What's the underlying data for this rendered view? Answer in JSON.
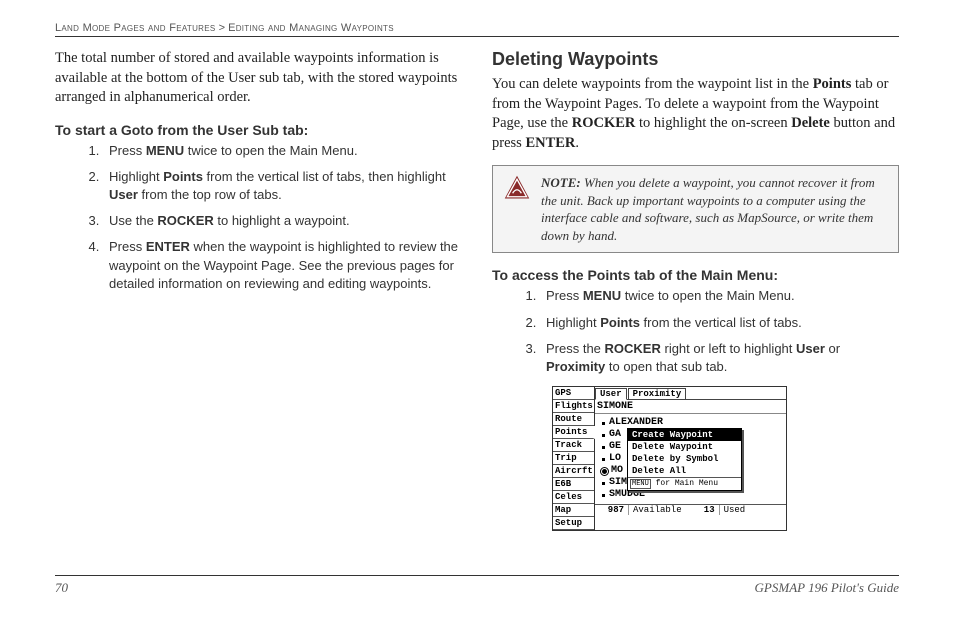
{
  "header": {
    "section": "Land Mode Pages and Features",
    "sep": " > ",
    "subsection": "Editing and Managing Waypoints"
  },
  "left": {
    "intro": "The total number of stored and available waypoints information is available at the bottom of the User sub tab, with the stored waypoints arranged in alphanumerical order.",
    "proc_title": "To start a Goto from the User Sub tab:",
    "steps": {
      "s1a": "Press ",
      "s1b": "MENU",
      "s1c": " twice to open the Main Menu.",
      "s2a": "Highlight ",
      "s2b": "Points",
      "s2c": " from the vertical list of tabs, then highlight ",
      "s2d": "User",
      "s2e": " from the top row of tabs.",
      "s3a": "Use the ",
      "s3b": "ROCKER",
      "s3c": " to highlight a waypoint.",
      "s4a": "Press ",
      "s4b": "ENTER",
      "s4c": " when the waypoint is highlighted to review the waypoint on the Waypoint Page. See the previous pages for detailed information on reviewing and editing waypoints."
    }
  },
  "right": {
    "title": "Deleting Waypoints",
    "p1a": "You can delete waypoints from the waypoint list in the ",
    "p1b": "Points",
    "p1c": " tab or from the Waypoint Pages. To delete a waypoint from the Waypoint Page, use the ",
    "p1d": "ROCKER",
    "p1e": " to highlight the on-screen ",
    "p1f": "Delete",
    "p1g": " button and press ",
    "p1h": "ENTER",
    "p1i": ".",
    "note_label": "NOTE:",
    "note_body": " When you delete a waypoint, you cannot recover it from the unit. Back up important waypoints to a computer using the interface cable and software, such as MapSource, or write them down by hand.",
    "proc_title": "To access the Points tab of the Main Menu:",
    "steps": {
      "s1a": "Press ",
      "s1b": "MENU",
      "s1c": " twice to open the Main Menu.",
      "s2a": "Highlight ",
      "s2b": "Points",
      "s2c": " from the vertical list of tabs.",
      "s3a": "Press the ",
      "s3b": "ROCKER",
      "s3c": " right or left to highlight ",
      "s3d": "User",
      "s3e": " or ",
      "s3f": "Proximity",
      "s3g": " to open that sub tab."
    }
  },
  "device": {
    "side": [
      "GPS",
      "Flights",
      "Route",
      "Points",
      "Track",
      "Trip",
      "Aircrft",
      "E6B",
      "Celes",
      "Map",
      "Setup"
    ],
    "side_selected_index": 3,
    "top": [
      "User",
      "Proximity"
    ],
    "top_selected_index": 0,
    "list_header": "SIMONE",
    "items": [
      "ALEXANDER",
      "GA",
      "GE",
      "LO",
      "MO",
      "SIMONE",
      "SMUDGE"
    ],
    "menu": {
      "rows": [
        "Create Waypoint",
        "Delete Waypoint",
        "Delete by Symbol",
        "Delete All"
      ],
      "selected_index": 0,
      "hint_prefix": "MENU",
      "hint_text": " for Main Menu"
    },
    "status": {
      "avail_num": "987",
      "avail_lbl": "Available",
      "used_num": "13",
      "used_lbl": "Used"
    }
  },
  "footer": {
    "page": "70",
    "book": "GPSMAP 196 Pilot's Guide"
  }
}
